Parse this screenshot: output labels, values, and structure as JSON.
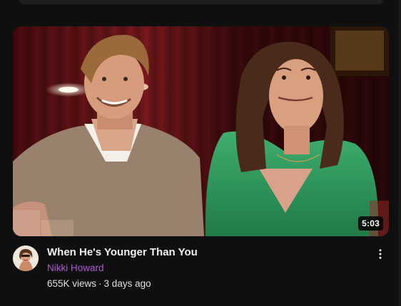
{
  "video": {
    "title": "When He's Younger Than You",
    "channel": "Nikki Howard",
    "views": "655K views",
    "separator": "·",
    "age": "3 days ago",
    "duration": "5:03"
  },
  "icons": {
    "menu": "more-vert-icon"
  },
  "colors": {
    "background": "#0f0f0f",
    "channel_name": "#b257d6",
    "title": "#f1f1f1"
  }
}
